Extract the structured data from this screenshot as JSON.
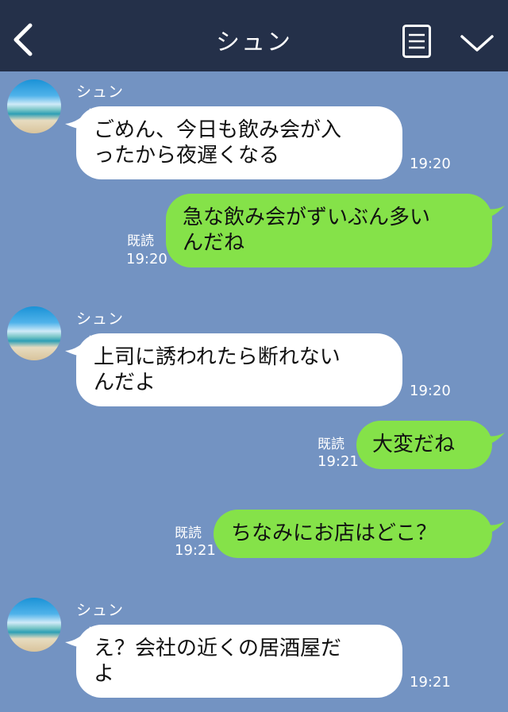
{
  "header": {
    "title": "シュン",
    "back_icon": "chevron-left-icon",
    "menu_icon": "menu-list-icon",
    "expand_icon": "chevron-down-icon"
  },
  "colors": {
    "header_bg": "#243049",
    "chat_bg": "#7393c2",
    "incoming_bubble": "#ffffff",
    "outgoing_bubble": "#85e249"
  },
  "messages": [
    {
      "direction": "in",
      "sender": "シュン",
      "lines": [
        "ごめん、今日も飲み会が入",
        "ったから夜遅くなる"
      ],
      "time": "19:20"
    },
    {
      "direction": "out",
      "lines": [
        "急な飲み会がずいぶん多い",
        "んだね"
      ],
      "read": "既読",
      "time": "19:20"
    },
    {
      "direction": "in",
      "sender": "シュン",
      "lines": [
        "上司に誘われたら断れない",
        "んだよ"
      ],
      "time": "19:20"
    },
    {
      "direction": "out",
      "lines": [
        "大変だね"
      ],
      "read": "既読",
      "time": "19:21"
    },
    {
      "direction": "out",
      "lines": [
        "ちなみにお店はどこ？"
      ],
      "read": "既読",
      "time": "19:21"
    },
    {
      "direction": "in",
      "sender": "シュン",
      "lines": [
        "え？会社の近くの居酒屋だ",
        "よ"
      ],
      "time": "19:21"
    }
  ]
}
